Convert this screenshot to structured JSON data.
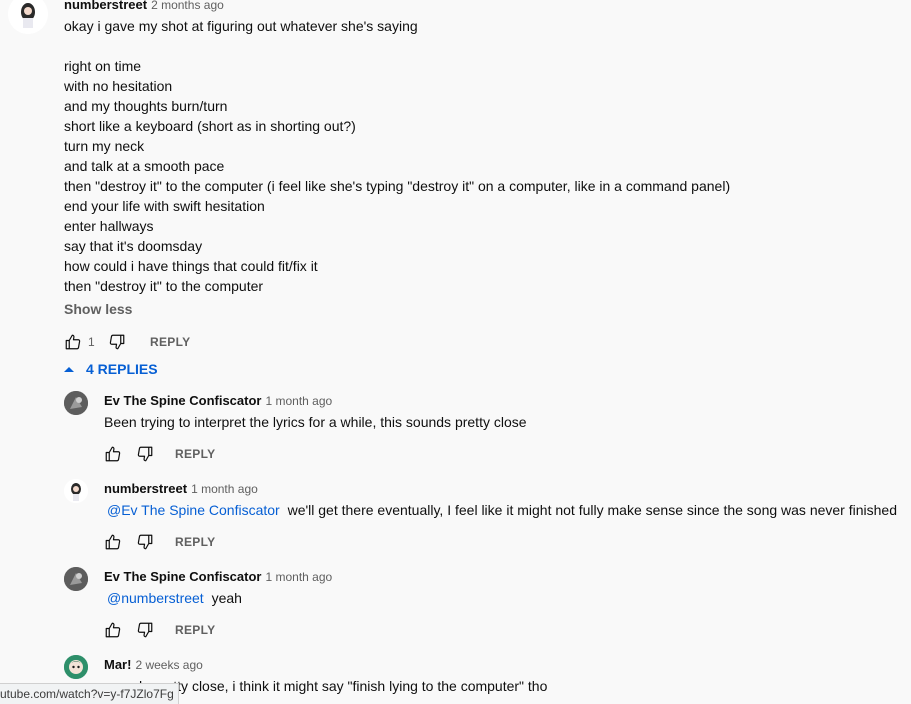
{
  "main_comment": {
    "author": "numberstreet",
    "time": "2 months ago",
    "lines": [
      "okay i gave my shot at figuring out whatever she's saying",
      "",
      "right on time",
      "with no hesitation",
      "and my thoughts burn/turn",
      "short like a keyboard (short as in shorting out?)",
      "turn my neck",
      "and talk at a smooth pace",
      "then \"destroy it\" to the computer (i feel like she's typing \"destroy it\" on a computer, like in a command panel)",
      "end your life with swift hesitation",
      "enter hallways",
      "say that it's doomsday",
      "how could i have things that could fit/fix it",
      "then \"destroy it\" to the computer"
    ],
    "show_less": "Show less",
    "like_count": "1",
    "reply_label": "REPLY"
  },
  "replies_toggle": {
    "label": "4 REPLIES"
  },
  "replies": [
    {
      "author": "Ev The Spine Confiscator",
      "time": "1 month ago",
      "mention": "",
      "text": "Been trying to interpret the lyrics for a while, this sounds pretty close",
      "reply_label": "REPLY"
    },
    {
      "author": "numberstreet",
      "time": "1 month ago",
      "mention": "@Ev The Spine Confiscator",
      "text": "we'll get there eventually, I feel like it might not fully make sense since the song was never finished",
      "reply_label": "REPLY"
    },
    {
      "author": "Ev The Spine Confiscator",
      "time": "1 month ago",
      "mention": "@numberstreet",
      "text": "yeah",
      "reply_label": "REPLY"
    },
    {
      "author": "Mar!",
      "time": "2 weeks ago",
      "mention": "",
      "text": "sounds pretty close, i think it might say \"finish lying to the computer\" tho",
      "reply_label": ""
    }
  ],
  "status_bar": {
    "url": "utube.com/watch?v=y-f7JZlo7Fg"
  },
  "colors": {
    "link": "#065fd4",
    "muted": "#606060",
    "background": "#f9f9f9"
  },
  "icons": [
    "thumb-up-icon",
    "thumb-down-icon",
    "chevron-up-icon"
  ]
}
